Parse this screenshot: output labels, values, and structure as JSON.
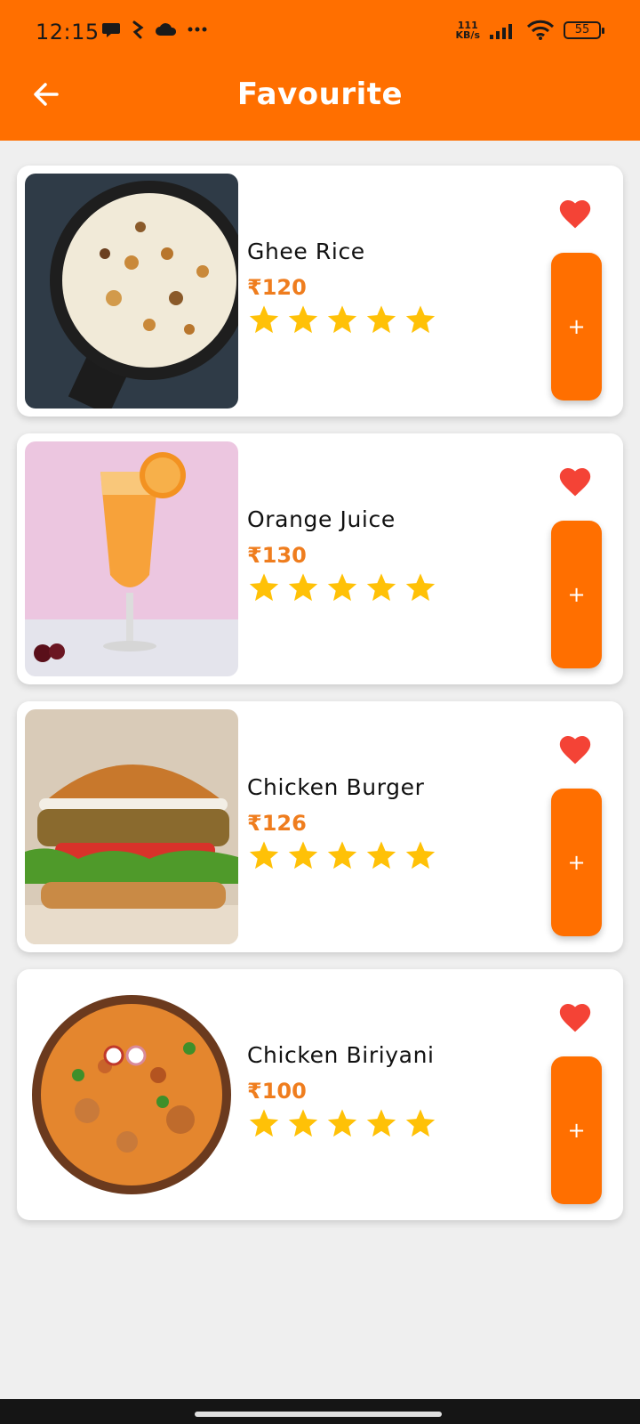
{
  "status_bar": {
    "time": "12:15",
    "net_speed_value": "111",
    "net_speed_unit": "KB/s",
    "battery": "55",
    "left_icons": [
      "chat-bubble-icon",
      "app-icon",
      "cloud-icon",
      "more-dots-icon"
    ],
    "right_icons": [
      "signal-icon",
      "wifi-icon",
      "battery-icon"
    ]
  },
  "app_bar": {
    "title": "Favourite",
    "back_icon": "arrow-back-icon",
    "background": "#ff6f00"
  },
  "items": [
    {
      "name": "Ghee Rice",
      "price": "₹120",
      "rating": 5,
      "image": "ghee-rice"
    },
    {
      "name": "Orange Juice",
      "price": "₹130",
      "rating": 5,
      "image": "orange-juice"
    },
    {
      "name": "Chicken Burger",
      "price": "₹126",
      "rating": 5,
      "image": "chicken-burger"
    },
    {
      "name": "Chicken Biriyani",
      "price": "₹100",
      "rating": 5,
      "image": "chicken-biriyani"
    }
  ],
  "add_label": "+",
  "colors": {
    "accent": "#ff6f00",
    "price": "#ef7d1e",
    "star": "#ffc107",
    "heart": "#f44336"
  }
}
